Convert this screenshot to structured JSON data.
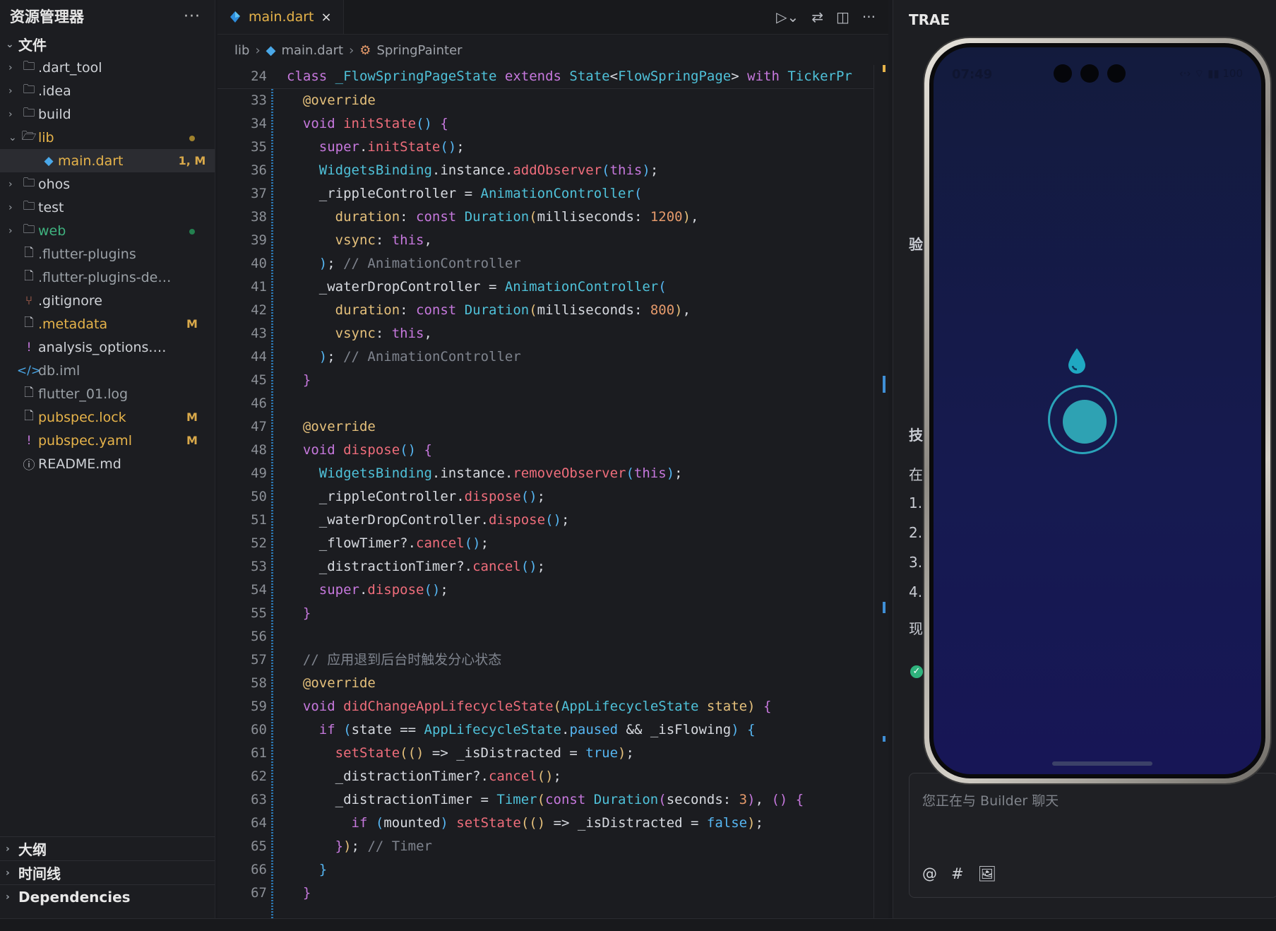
{
  "sidebar": {
    "title": "资源管理器",
    "more": "···",
    "section_files": "文件",
    "items": [
      {
        "label": ".dart_tool",
        "type": "folder",
        "chevron": "›",
        "icon": "🗀",
        "badge": "",
        "color": "#cfd2d7"
      },
      {
        "label": ".idea",
        "type": "folder",
        "chevron": "›",
        "icon": "🗀",
        "badge": "",
        "color": "#cfd2d7"
      },
      {
        "label": "build",
        "type": "folder",
        "chevron": "›",
        "icon": "🗀",
        "badge": "",
        "color": "#cfd2d7"
      },
      {
        "label": "lib",
        "type": "folder-open",
        "chevron": "⌄",
        "icon": "🗁",
        "badge": "dot-amber",
        "color": "#e6b34a"
      },
      {
        "label": "main.dart",
        "type": "dart",
        "chevron": "",
        "icon": "◆",
        "badge": "1, M",
        "color": "#e6b34a"
      },
      {
        "label": "ohos",
        "type": "folder",
        "chevron": "›",
        "icon": "🗀",
        "badge": "",
        "color": "#cfd2d7"
      },
      {
        "label": "test",
        "type": "folder",
        "chevron": "›",
        "icon": "🗀",
        "badge": "",
        "color": "#cfd2d7"
      },
      {
        "label": "web",
        "type": "folder",
        "chevron": "›",
        "icon": "🗀",
        "badge": "dot-green",
        "color": "#3fb27f"
      },
      {
        "label": ".flutter-plugins",
        "type": "file",
        "chevron": "",
        "icon": "🗋",
        "badge": "",
        "color": "#9aa0a6"
      },
      {
        "label": ".flutter-plugins-dependen...",
        "type": "file",
        "chevron": "",
        "icon": "🗋",
        "badge": "",
        "color": "#9aa0a6"
      },
      {
        "label": ".gitignore",
        "type": "git",
        "chevron": "",
        "icon": "⑂",
        "badge": "",
        "color": "#cfd2d7"
      },
      {
        "label": ".metadata",
        "type": "file",
        "chevron": "",
        "icon": "🗋",
        "badge": "M",
        "color": "#e6b34a"
      },
      {
        "label": "analysis_options.yaml",
        "type": "yaml",
        "chevron": "",
        "icon": "!",
        "badge": "",
        "color": "#cfd2d7"
      },
      {
        "label": "db.iml",
        "type": "xml",
        "chevron": "",
        "icon": "</>",
        "badge": "",
        "color": "#9aa0a6"
      },
      {
        "label": "flutter_01.log",
        "type": "file",
        "chevron": "",
        "icon": "🗋",
        "badge": "",
        "color": "#9aa0a6"
      },
      {
        "label": "pubspec.lock",
        "type": "file",
        "chevron": "",
        "icon": "🗋",
        "badge": "M",
        "color": "#e6b34a"
      },
      {
        "label": "pubspec.yaml",
        "type": "yaml",
        "chevron": "",
        "icon": "!",
        "badge": "M",
        "color": "#e6b34a"
      },
      {
        "label": "README.md",
        "type": "info",
        "chevron": "",
        "icon": "ⓘ",
        "badge": "",
        "color": "#cfd2d7"
      }
    ],
    "bottom_sections": [
      "大纲",
      "时间线",
      "Dependencies"
    ]
  },
  "editor": {
    "tab_label": "main.dart",
    "tab_close": "×",
    "breadcrumb": [
      "lib",
      "main.dart",
      "SpringPainter"
    ],
    "sticky_line": {
      "n": "24",
      "html": "<span class='kw'>class</span> <span class='ty'>_FlowSpringPageState</span> <span class='kw'>extends</span> <span class='ty'>State</span>&lt;<span class='ty'>FlowSpringPage</span>&gt; <span class='kw'>with</span> <span class='ty'>TickerPr</span>"
    },
    "lines": [
      {
        "n": "33",
        "html": "  <span class='an'>@override</span>"
      },
      {
        "n": "34",
        "html": "  <span class='kw'>void</span> <span class='fn'>initState</span><span class='pu'>()</span> <span class='kw'>{</span>"
      },
      {
        "n": "35",
        "html": "    <span class='kw'>super</span>.<span class='fn'>initState</span><span class='pu'>()</span>;"
      },
      {
        "n": "36",
        "html": "    <span class='ty'>WidgetsBinding</span>.instance.<span class='fn'>addObserver</span><span class='pu'>(</span><span class='kw'>this</span><span class='pu'>)</span>;"
      },
      {
        "n": "37",
        "html": "    _rippleController = <span class='ty'>AnimationController</span><span class='pu'>(</span>"
      },
      {
        "n": "38",
        "html": "      <span class='pa'>duration</span>: <span class='kw'>const</span> <span class='ty'>Duration</span><span class='pa'>(</span>milliseconds: <span class='num'>1200</span><span class='pa'>)</span>,"
      },
      {
        "n": "39",
        "html": "      <span class='pa'>vsync</span>: <span class='kw'>this</span>,"
      },
      {
        "n": "40",
        "html": "    <span class='pu'>)</span>; <span class='cm'>// AnimationController</span>"
      },
      {
        "n": "41",
        "html": "    _waterDropController = <span class='ty'>AnimationController</span><span class='pu'>(</span>"
      },
      {
        "n": "42",
        "html": "      <span class='pa'>duration</span>: <span class='kw'>const</span> <span class='ty'>Duration</span><span class='pa'>(</span>milliseconds: <span class='num'>800</span><span class='pa'>)</span>,"
      },
      {
        "n": "43",
        "html": "      <span class='pa'>vsync</span>: <span class='kw'>this</span>,"
      },
      {
        "n": "44",
        "html": "    <span class='pu'>)</span>; <span class='cm'>// AnimationController</span>"
      },
      {
        "n": "45",
        "html": "  <span class='kw'>}</span>"
      },
      {
        "n": "46",
        "html": ""
      },
      {
        "n": "47",
        "html": "  <span class='an'>@override</span>"
      },
      {
        "n": "48",
        "html": "  <span class='kw'>void</span> <span class='fn'>dispose</span><span class='pu'>()</span> <span class='kw'>{</span>"
      },
      {
        "n": "49",
        "html": "    <span class='ty'>WidgetsBinding</span>.instance.<span class='fn'>removeObserver</span><span class='pu'>(</span><span class='kw'>this</span><span class='pu'>)</span>;"
      },
      {
        "n": "50",
        "html": "    _rippleController.<span class='fn'>dispose</span><span class='pu'>()</span>;"
      },
      {
        "n": "51",
        "html": "    _waterDropController.<span class='fn'>dispose</span><span class='pu'>()</span>;"
      },
      {
        "n": "52",
        "html": "    _flowTimer?.<span class='fn'>cancel</span><span class='pu'>()</span>;"
      },
      {
        "n": "53",
        "html": "    _distractionTimer?.<span class='fn'>cancel</span><span class='pu'>()</span>;"
      },
      {
        "n": "54",
        "html": "    <span class='kw'>super</span>.<span class='fn'>dispose</span><span class='pu'>()</span>;"
      },
      {
        "n": "55",
        "html": "  <span class='kw'>}</span>"
      },
      {
        "n": "56",
        "html": ""
      },
      {
        "n": "57",
        "html": "  <span class='cm'>// 应用退到后台时触发分心状态</span>"
      },
      {
        "n": "58",
        "html": "  <span class='an'>@override</span>"
      },
      {
        "n": "59",
        "html": "  <span class='kw'>void</span> <span class='fn'>didChangeAppLifecycleState</span><span class='pa'>(</span><span class='ty'>AppLifecycleState</span> <span class='pa'>state</span><span class='pa'>)</span> <span class='kw'>{</span>"
      },
      {
        "n": "60",
        "html": "    <span class='kw'>if</span> <span class='pu'>(</span>state == <span class='ty'>AppLifecycleState</span>.<span class='pu'>paused</span> &amp;&amp; _isFlowing<span class='pu'>)</span> <span class='pu'>{</span>"
      },
      {
        "n": "61",
        "html": "      <span class='fn'>setState</span><span class='pa'>(()</span> =&gt; _isDistracted = <span class='pu'>true</span><span class='pa'>)</span>;"
      },
      {
        "n": "62",
        "html": "      _distractionTimer?.<span class='fn'>cancel</span><span class='pa'>()</span>;"
      },
      {
        "n": "63",
        "html": "      _distractionTimer = <span class='ty'>Timer</span><span class='pa'>(</span><span class='kw'>const</span> <span class='ty'>Duration</span><span class='kw'>(</span>seconds: <span class='num'>3</span><span class='kw'>)</span>, <span class='kw'>()</span> <span class='kw'>{</span>"
      },
      {
        "n": "64",
        "html": "        <span class='kw'>if</span> <span class='pu'>(</span>mounted<span class='pu'>)</span> <span class='fn'>setState</span><span class='pa'>(()</span> =&gt; _isDistracted = <span class='pu'>false</span><span class='pa'>)</span>;"
      },
      {
        "n": "65",
        "html": "      <span class='kw'>}</span><span class='pa'>)</span>; <span class='cm'>// Timer</span>"
      },
      {
        "n": "66",
        "html": "    <span class='pu'>}</span>"
      },
      {
        "n": "67",
        "html": "  <span class='kw'>}</span>"
      }
    ]
  },
  "right_panel": {
    "title": "TRAE",
    "chat_placeholder": "您正在与 Builder 聊天",
    "chat_tools": [
      "@",
      "#",
      "🖼"
    ]
  },
  "phone": {
    "time": "07:49",
    "status_icons": "‹·› ⌔ ▮▮ 100"
  },
  "colors": {
    "accent_amber": "#e6b34a",
    "git_green": "#3fb27f",
    "drop_cyan": "#2aa3b9"
  }
}
